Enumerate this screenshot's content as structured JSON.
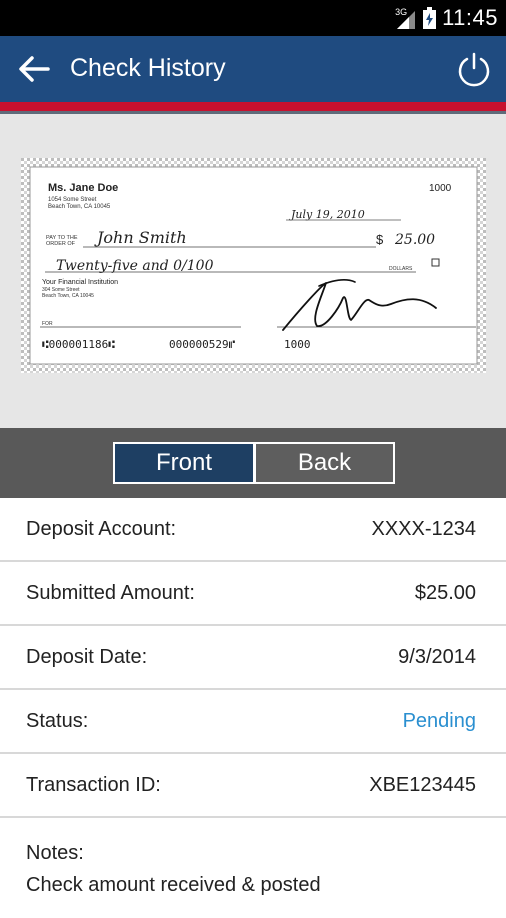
{
  "status_bar": {
    "network": "3G",
    "time": "11:45"
  },
  "app_bar": {
    "title": "Check History"
  },
  "check": {
    "payer_name": "Ms. Jane Doe",
    "payer_address_1": "1054 Some Street",
    "payer_address_2": "Beach Town, CA 10045",
    "check_number": "1000",
    "date": "July 19, 2010",
    "pay_to_label_1": "PAY TO THE",
    "pay_to_label_2": "ORDER OF",
    "payee": "John Smith",
    "dollar_sign": "$",
    "amount": "25.00",
    "amount_words": "Twenty-five and 0/100",
    "dollars_label": "DOLLARS",
    "bank_name": "Your Financial Institution",
    "bank_address_1": "304 Some Street",
    "bank_address_2": "Beach Town, CA 10045",
    "memo_label": "FOR",
    "micr_routing": "⑆000001186⑆",
    "micr_account": "000000529⑈",
    "micr_check": "1000"
  },
  "toggle": {
    "front_label": "Front",
    "back_label": "Back",
    "selected": "Front"
  },
  "details": [
    {
      "label": "Deposit Account:",
      "value": "XXXX-1234"
    },
    {
      "label": "Submitted Amount:",
      "value": "$25.00"
    },
    {
      "label": "Deposit Date:",
      "value": "9/3/2014"
    },
    {
      "label": "Status:",
      "value": "Pending"
    },
    {
      "label": "Transaction ID:",
      "value": "XBE123445"
    }
  ],
  "notes": {
    "label": "Notes:",
    "text": "Check amount received & posted"
  },
  "colors": {
    "app_bar": "#1f4b80",
    "accent_red": "#c8102e",
    "toggle_selected": "#1e3f63",
    "toggle_band": "#595959",
    "status_pending": "#2a8fd0"
  }
}
